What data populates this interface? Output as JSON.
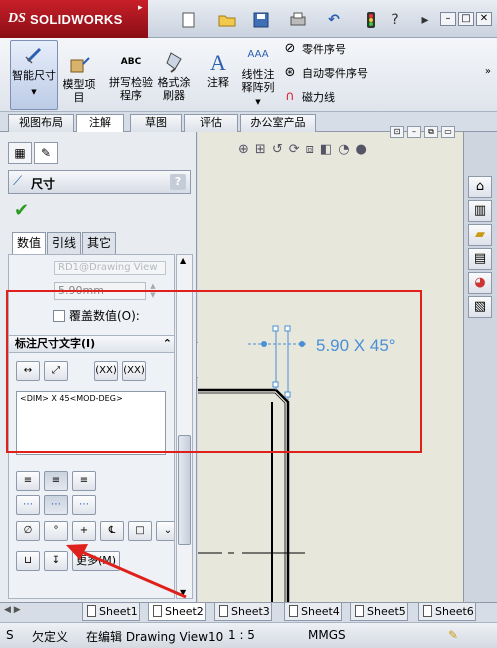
{
  "app": {
    "brand": "SOLIDWORKS",
    "brand_prefix": "DS"
  },
  "quick_access": {
    "icons": [
      "new-file-icon",
      "open-folder-icon",
      "save-icon",
      "print-icon",
      "undo-icon",
      "rebuild-icon",
      "help-icon",
      "select-icon"
    ],
    "window": {
      "min": "–",
      "restore": "□",
      "close": "✕"
    }
  },
  "ribbon": {
    "smart_dimension": "智能尺寸",
    "model_items": "模型项目",
    "spell_check": "拼写检验程序",
    "format_painter": "格式涂刷器",
    "note": "注释",
    "linear_note_pattern": "线性注释阵列",
    "balloon": "零件序号",
    "auto_balloon": "自动零件序号",
    "magnetic_line": "磁力线",
    "spell_abc": "ABC"
  },
  "command_tabs": [
    "视图布局",
    "注解",
    "草图",
    "评估",
    "办公室产品"
  ],
  "property_manager": {
    "title": "尺寸",
    "help": "?",
    "tabs": [
      "数值",
      "引线",
      "其它"
    ],
    "ghost_value": "RD1@Drawing View",
    "value": "5.90mm",
    "override_label": "覆盖数值(O):",
    "override_checked": false,
    "dim_text_group": "标注尺寸文字(I)",
    "dim_text": "<DIM> X 45<MOD-DEG>",
    "xx_label": "(XX)",
    "symbol_diameter": "∅",
    "symbol_degree": "°",
    "symbol_plusminus": "+",
    "more_button": "更多(M)"
  },
  "drawing": {
    "dimension_label": "5.90 X 45°"
  },
  "sheets": [
    "Sheet1",
    "Sheet2",
    "Sheet3",
    "Sheet4",
    "Sheet5",
    "Sheet6"
  ],
  "active_sheet": "Sheet2",
  "status": {
    "s0": "S",
    "definition": "欠定义",
    "editing": "在编辑 Drawing View10",
    "scale": "1 : 5",
    "units": "MMGS"
  },
  "colors": {
    "annotation_red": "#e0201b",
    "dimension_blue": "#4a8fd6"
  }
}
